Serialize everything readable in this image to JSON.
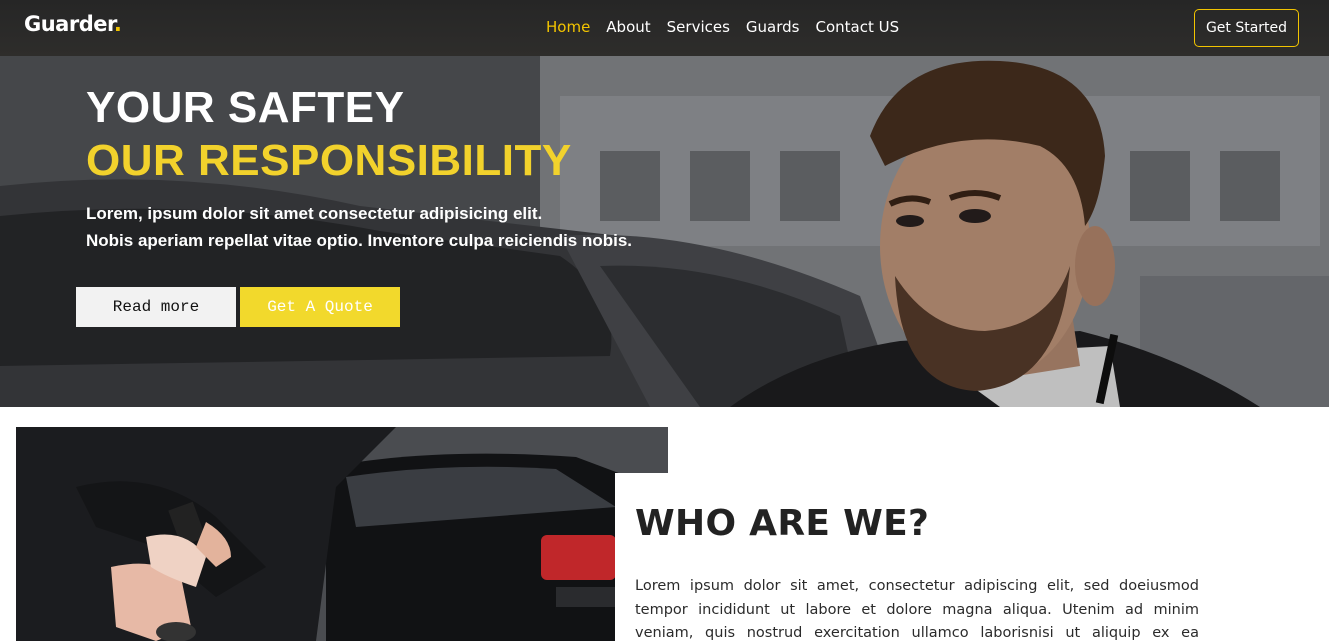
{
  "brand": {
    "name": "Guarder",
    "dot": ".",
    "accent_color": "#f2c400"
  },
  "nav": {
    "links": [
      {
        "label": "Home",
        "active": true
      },
      {
        "label": "About",
        "active": false
      },
      {
        "label": "Services",
        "active": false
      },
      {
        "label": "Guards",
        "active": false
      },
      {
        "label": "Contact US",
        "active": false
      }
    ],
    "cta_label": "Get Started"
  },
  "hero": {
    "title_line1": "YOUR SAFTEY",
    "title_line2": "OUR RESPONSIBILITY",
    "subtitle_line1": "Lorem, ipsum dolor sit amet consectetur adipisicing elit.",
    "subtitle_line2": "Nobis aperiam repellat vitae optio. Inventore culpa reiciendis nobis.",
    "read_more_label": "Read more",
    "quote_label": "Get A Quote",
    "highlight_color": "#f2d22c"
  },
  "about": {
    "title": "WHO ARE WE?",
    "body": "Lorem ipsum dolor sit amet, consectetur adipiscing elit, sed doeiusmod tempor incididunt ut labore et dolore magna aliqua. Utenim ad minim veniam, quis nostrud exercitation ullamco laborisnisi ut aliquip ex ea commodo consequat."
  }
}
